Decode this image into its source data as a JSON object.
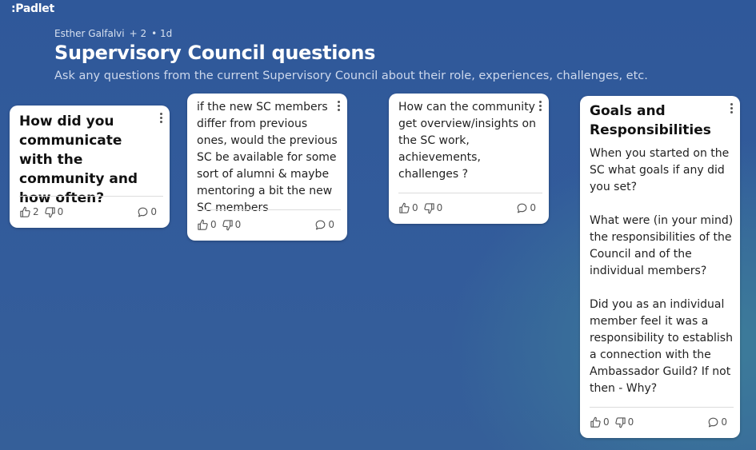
{
  "app": {
    "logo": ":Padlet"
  },
  "header": {
    "author": "Esther Galfalvi",
    "collaborators": "+ 2",
    "age": "• 1d",
    "title": "Supervisory Council questions",
    "subtitle": "Ask any questions from the current Supervisory Council about their role, experiences, challenges, etc."
  },
  "cards": [
    {
      "title": "How did you communicate with the community and how often?",
      "body": "",
      "likes": "2",
      "dislikes": "0",
      "comments": "0"
    },
    {
      "title": "",
      "body": "if the new SC members differ from previous ones, would the previous SC be available for some sort of alumni & maybe mentoring a bit the new SC members",
      "likes": "0",
      "dislikes": "0",
      "comments": "0"
    },
    {
      "title": "",
      "body": "How can the community get overview/insights on the SC work, achievements, challenges ?",
      "likes": "0",
      "dislikes": "0",
      "comments": "0"
    },
    {
      "title": "Goals and Responsibilities",
      "body": "When you started on the SC what goals if any did you set?\n\nWhat were (in your mind) the responsibilities of the Council and of the individual members?\n\nDid you as an individual member feel it was a responsibility to establish a connection with the Ambassador Guild? If not then - Why?",
      "likes": "0",
      "dislikes": "0",
      "comments": "0"
    }
  ]
}
